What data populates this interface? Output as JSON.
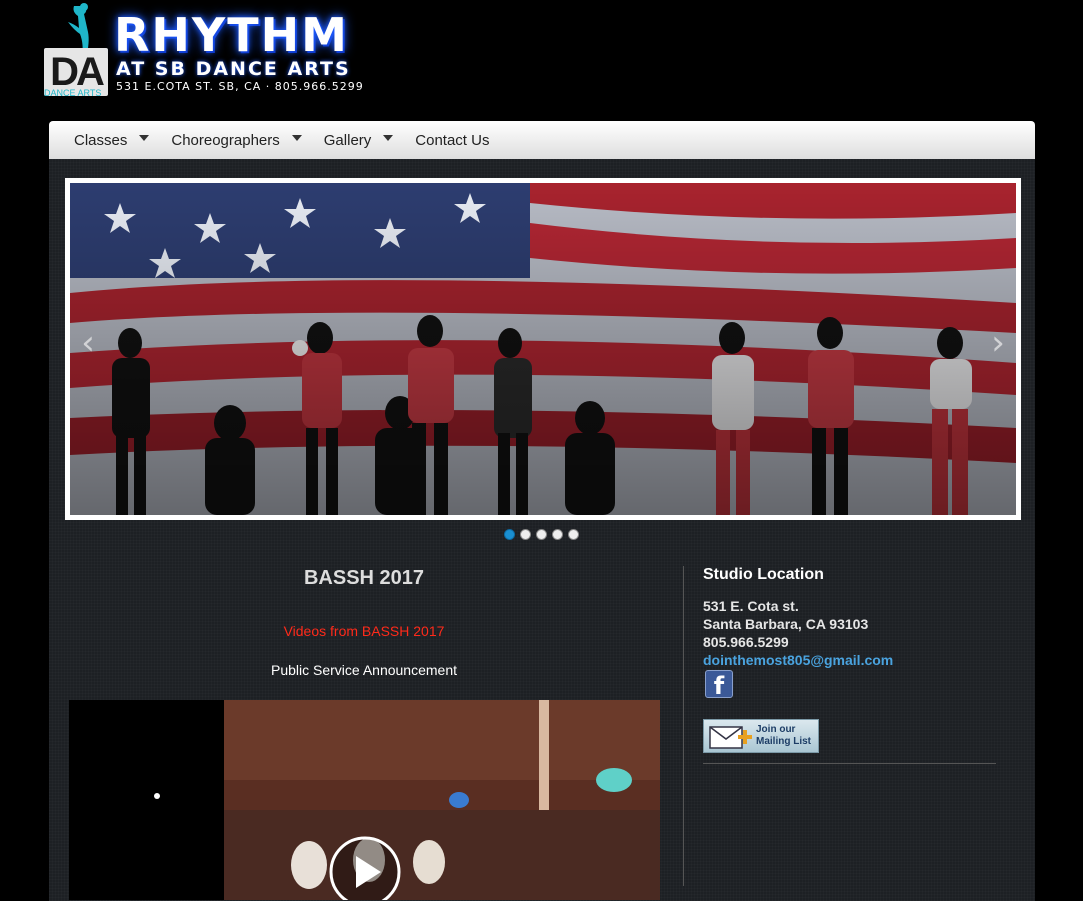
{
  "logo": {
    "mark": "DA",
    "mark_sub": "DANCE ARTS",
    "title": "RHYTHM",
    "subtitle": "AT SB DANCE ARTS",
    "address": "531 E.COTA ST. SB, CA · 805.966.5299"
  },
  "nav": {
    "items": [
      {
        "label": "Classes",
        "has_dropdown": true
      },
      {
        "label": "Choreographers",
        "has_dropdown": true
      },
      {
        "label": "Gallery",
        "has_dropdown": true
      },
      {
        "label": "Contact Us",
        "has_dropdown": false
      }
    ]
  },
  "slider": {
    "prev_icon": "chevron-left-icon",
    "next_icon": "chevron-right-icon",
    "dot_count": 5,
    "active_dot": 1
  },
  "post": {
    "title": "BASSH 2017",
    "link_text": "Videos from BASSH 2017",
    "caption": "Public Service Announcement"
  },
  "sidebar": {
    "title": "Studio Location",
    "address_line1": "531 E. Cota st.",
    "address_line2": "Santa Barbara, CA 93103",
    "phone": "805.966.5299",
    "email": "dointhemost805@gmail.com",
    "facebook_icon": "facebook-icon",
    "mailing_line1": "Join our",
    "mailing_line2": "Mailing List"
  },
  "colors": {
    "accent_blue": "#1a8fd1",
    "link_red": "#ff2a1a",
    "email_blue": "#4aa3df",
    "logo_glow": "#1e5bff"
  }
}
